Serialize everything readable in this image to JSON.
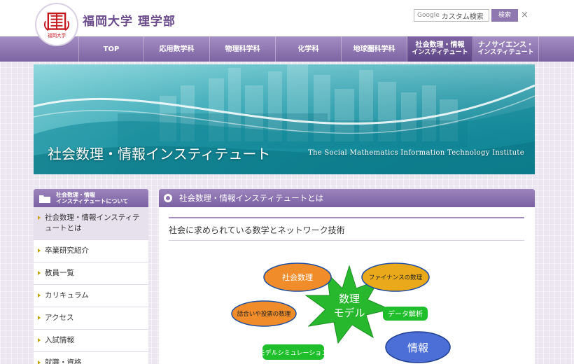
{
  "header": {
    "site_title": "福岡大学 理学部",
    "logo_alt_text": "福岡大学",
    "search_placeholder_brand": "Google",
    "search_placeholder": "カスタム検索",
    "search_button": "検索",
    "close_glyph": "×"
  },
  "nav": {
    "items": [
      {
        "label": "TOP",
        "sub": ""
      },
      {
        "label": "応用数学科",
        "sub": ""
      },
      {
        "label": "物理科学科",
        "sub": ""
      },
      {
        "label": "化学科",
        "sub": ""
      },
      {
        "label": "地球圏科学科",
        "sub": ""
      },
      {
        "label": "社会数理・情報",
        "sub": "インスティテュート"
      },
      {
        "label": "ナノサイエンス・",
        "sub": "インスティテュート"
      }
    ]
  },
  "banner": {
    "title": "社会数理・情報インスティテュート",
    "subtitle": "The Social Mathematics Information Technology Institute"
  },
  "sidebar": {
    "heading_line1": "社会数理・情報",
    "heading_line2": "インスティテュートについて",
    "items": [
      {
        "label": "社会数理・情報インスティテュートとは"
      },
      {
        "label": "卒業研究紹介"
      },
      {
        "label": "教員一覧"
      },
      {
        "label": "カリキュラム"
      },
      {
        "label": "アクセス"
      },
      {
        "label": "入試情報"
      },
      {
        "label": "就職・資格"
      }
    ]
  },
  "main": {
    "heading": "社会数理・情報インスティテュートとは",
    "subheading": "社会に求められている数学とネットワーク技術",
    "diagram": {
      "center_line1": "数理",
      "center_line2": "モデル",
      "nodes": {
        "social_math": "社会数理",
        "finance": "ファイナンスの数理",
        "voting": "話合いや投票の数理",
        "data": "データ解析",
        "info": "情報",
        "simulation": "モデルシミュレーション"
      }
    }
  },
  "colors": {
    "nav_purple": "#7c63a3",
    "title_purple": "#6b4a8c",
    "banner_teal": "#158d9d",
    "star_green": "#27b82e",
    "oval_orange": "#f08d2a"
  }
}
